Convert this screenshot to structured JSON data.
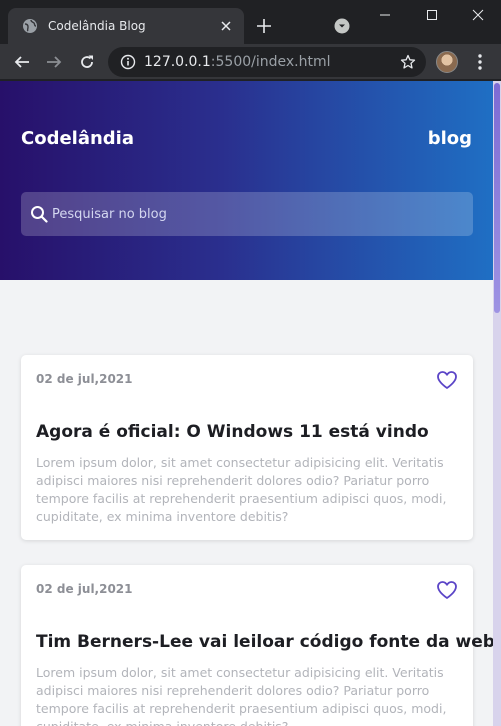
{
  "browser": {
    "tab_title": "Codelândia Blog",
    "url_host": "127.0.0.1",
    "url_path": ":5500/index.html"
  },
  "header": {
    "brand": "Codelândia",
    "nav_link": "blog",
    "search_placeholder": "Pesquisar no blog"
  },
  "posts": [
    {
      "date": "02 de jul,2021",
      "title": "Agora é oficial: O Windows 11 está vindo",
      "excerpt": "Lorem ipsum dolor, sit amet consectetur adipisicing elit. Veritatis adipisci maiores nisi reprehenderit dolores odio? Pariatur porro tempore facilis at reprehenderit praesentium adipisci quos, modi, cupiditate, ex minima inventore debitis?"
    },
    {
      "date": "02 de jul,2021",
      "title": "Tim Berners-Lee vai leiloar código fonte da web",
      "excerpt": "Lorem ipsum dolor, sit amet consectetur adipisicing elit. Veritatis adipisci maiores nisi reprehenderit dolores odio? Pariatur porro tempore facilis at reprehenderit praesentium adipisci quos, modi, cupiditate, ex minima inventore debitis?"
    }
  ],
  "colors": {
    "header_start": "#27106a",
    "header_end": "#1f6fc4",
    "accent": "#5b45c7",
    "page_bg": "#f2f3f5"
  },
  "icons": [
    "globe-icon",
    "close-icon",
    "plus-icon",
    "tab-search-icon",
    "minimize-icon",
    "maximize-icon",
    "window-close-icon",
    "back-arrow-icon",
    "forward-arrow-icon",
    "reload-icon",
    "info-icon",
    "star-icon",
    "avatar",
    "kebab-menu-icon",
    "search-icon",
    "heart-icon"
  ]
}
